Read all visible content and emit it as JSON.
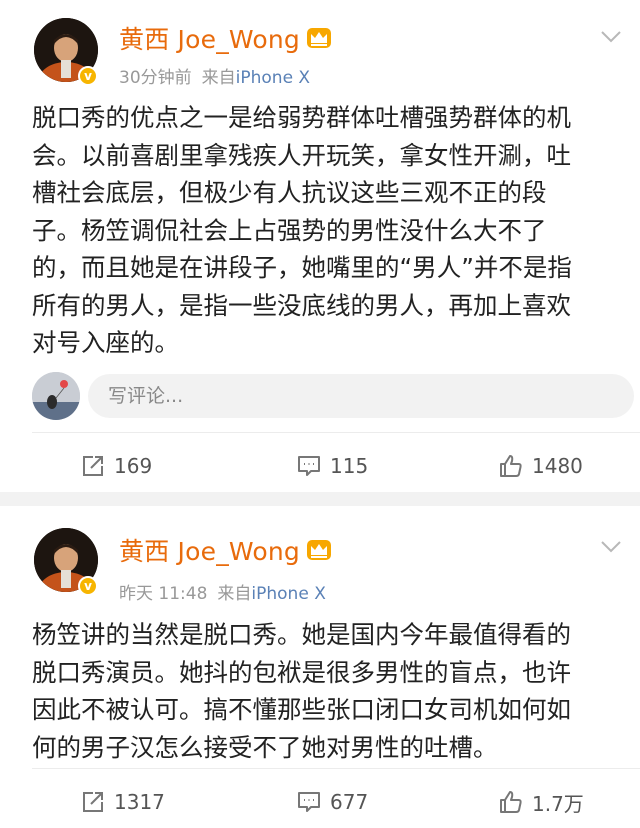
{
  "posts": [
    {
      "user_name": "黄西 Joe_Wong",
      "time": "30分钟前",
      "source_prefix": "来自",
      "source_device": "iPhone X",
      "text": "脱口秀的优点之一是给弱势群体吐槽强势群体的机\n会。以前喜剧里拿残疾人开玩笑，拿女性开涮，吐\n槽社会底层，但极少有人抗议这些三观不正的段\n子。杨笠调侃社会上占强势的男性没什么大不了\n的，而且她是在讲段子，她嘴里的“男人”并不是指\n所有的男人，是指一些没底线的男人，再加上喜欢\n对号入座的。",
      "comment_placeholder": "写评论...",
      "reposts": "169",
      "comments": "115",
      "likes": "1480"
    },
    {
      "user_name": "黄西 Joe_Wong",
      "time": "昨天 11:48",
      "source_prefix": "来自",
      "source_device": "iPhone X",
      "text": "杨笠讲的当然是脱口秀。她是国内今年最值得看的\n脱口秀演员。她抖的包袱是很多男性的盲点，也许\n因此不被认可。搞不懂那些张口闭口女司机如何如\n何的男子汉怎么接受不了她对男性的吐槽。",
      "reposts": "1317",
      "comments": "677",
      "likes": "1.7万"
    }
  ],
  "icons": {
    "verified": "verified-badge-icon",
    "vip": "crown-icon",
    "menu": "chevron-down-icon",
    "repost": "repost-icon",
    "comment": "comment-icon",
    "like": "thumbs-up-icon"
  },
  "colors": {
    "user_name": "#e86b0c",
    "device_link": "#5a81b6",
    "meta": "#999999",
    "verified": "#f7b500",
    "separator": "#f2f2f2"
  }
}
